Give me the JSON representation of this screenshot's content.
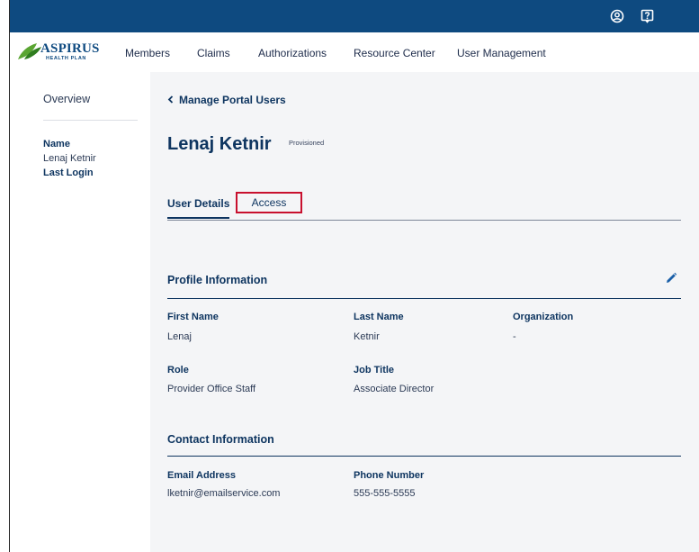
{
  "topbar": {
    "icons": [
      "account-circle-icon",
      "help-icon"
    ]
  },
  "logo": {
    "brand": "ASPIRUS",
    "sub": "HEALTH PLAN"
  },
  "nav": {
    "items": [
      "Members",
      "Claims",
      "Authorizations",
      "Resource Center",
      "User Management"
    ]
  },
  "sidebar": {
    "overview": "Overview",
    "name_label": "Name",
    "name_value": "Lenaj Ketnir",
    "last_login_label": "Last Login"
  },
  "main": {
    "back_link": "Manage Portal Users",
    "user_name": "Lenaj Ketnir",
    "status": "Provisioned",
    "tabs": [
      "User Details",
      "Access"
    ],
    "profile": {
      "title": "Profile Information",
      "fields": [
        {
          "label": "First Name",
          "value": "Lenaj"
        },
        {
          "label": "Last Name",
          "value": "Ketnir"
        },
        {
          "label": "Organization",
          "value": "-"
        },
        {
          "label": "Role",
          "value": "Provider Office Staff"
        },
        {
          "label": "Job Title",
          "value": "Associate Director"
        }
      ]
    },
    "contact": {
      "title": "Contact Information",
      "fields": [
        {
          "label": "Email Address",
          "value": "lketnir@emailservice.com"
        },
        {
          "label": "Phone Number",
          "value": "555-555-5555"
        }
      ]
    }
  },
  "colors": {
    "topbar": "#0e4a80",
    "accent_text": "#0e3560",
    "highlight_border": "#c8102e",
    "edit_icon": "#1a5fa8"
  }
}
